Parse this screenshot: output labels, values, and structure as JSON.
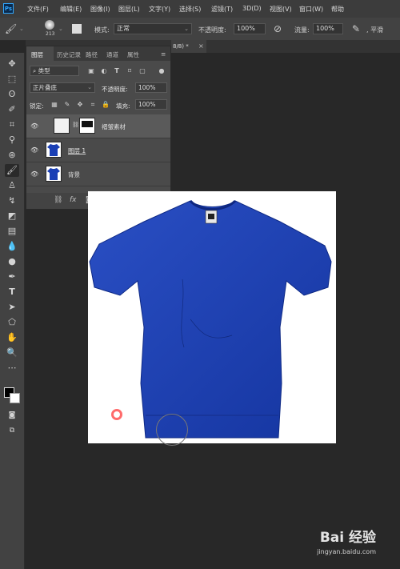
{
  "app": {
    "logo": "Ps"
  },
  "menu": [
    "文件(F)",
    "编辑(E)",
    "图像(I)",
    "图层(L)",
    "文字(Y)",
    "选择(S)",
    "滤镜(T)",
    "3D(D)",
    "视图(V)",
    "窗口(W)",
    "帮助"
  ],
  "options": {
    "brush_size": "213",
    "mode_label": "模式:",
    "mode_value": "正常",
    "opacity_label": "不透明度:",
    "opacity_value": "100%",
    "flow_label": "流量:",
    "flow_value": "100%",
    "smoothing_label": "平滑"
  },
  "document_tab": {
    "label": "8/8) *",
    "close": "×"
  },
  "layers_panel": {
    "tabs": [
      "图层",
      "历史记录",
      "路径",
      "通道",
      "属性"
    ],
    "filter_kind": "类型",
    "blend_mode": "正片叠底",
    "opacity_label": "不透明度:",
    "opacity_value": "100%",
    "lock_label": "锁定:",
    "fill_label": "填充:",
    "fill_value": "100%",
    "layers": [
      {
        "name": "褶皱素材",
        "selected": true
      },
      {
        "name": "图层 1",
        "selected": false
      },
      {
        "name": "背景",
        "selected": false
      }
    ]
  },
  "colors": {
    "tshirt": "#1a3fb5",
    "ps_blue": "#31a8ff",
    "cursor_red": "#ff6b6b"
  },
  "watermark": {
    "logo": "Bai 经验",
    "url": "jingyan.baidu.com"
  }
}
